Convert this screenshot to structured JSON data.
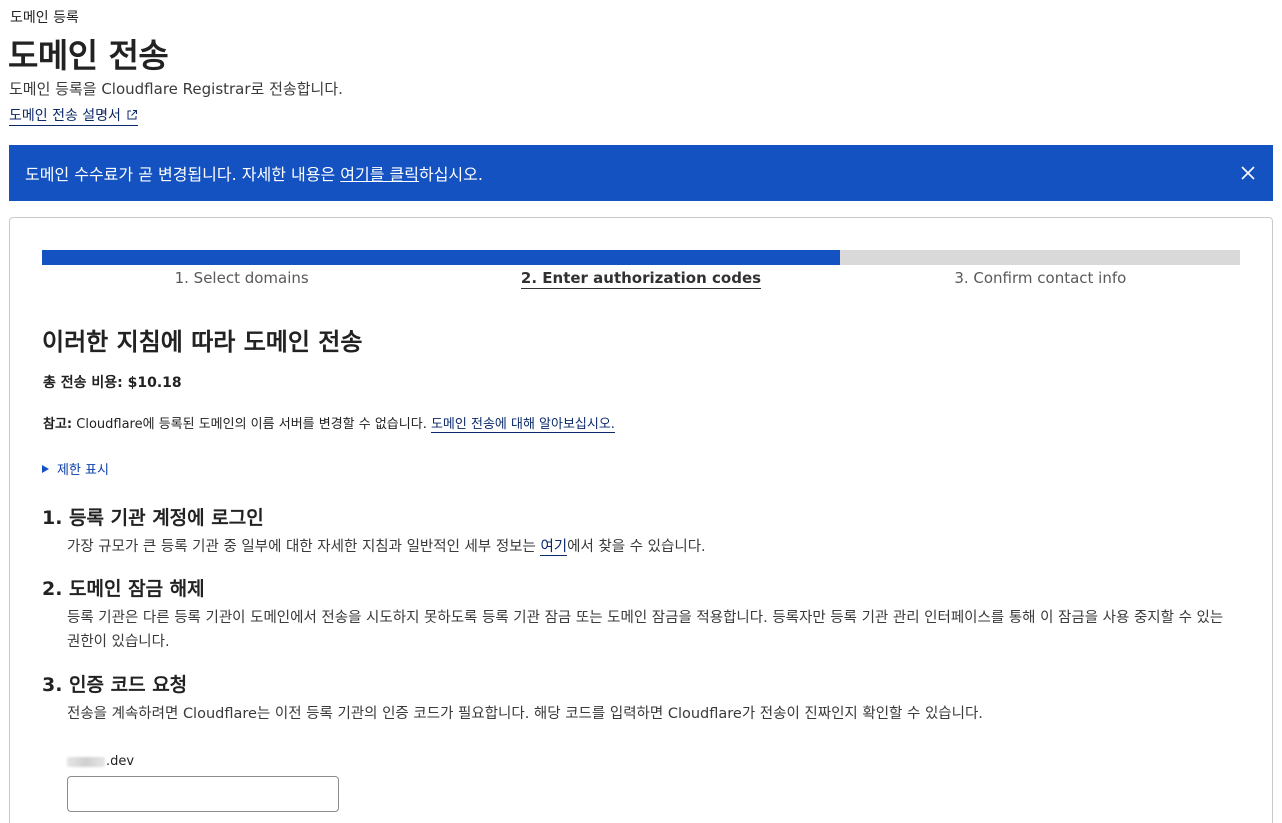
{
  "header": {
    "breadcrumb": "도메인 등록",
    "title": "도메인 전송",
    "subtitle": "도메인 등록을 Cloudflare Registrar로 전송합니다.",
    "doc_link": "도메인 전송 설명서"
  },
  "banner": {
    "text_before": "도메인 수수료가 곧 변경됩니다. 자세한 내용은 ",
    "link": "여기를 클릭",
    "text_after": "하십시오.",
    "color": "#1352c0"
  },
  "progress": {
    "fraction": 0.666,
    "steps": [
      {
        "label": "1. Select domains",
        "active": false
      },
      {
        "label": "2. Enter authorization codes",
        "active": true
      },
      {
        "label": "3. Confirm contact info",
        "active": false
      }
    ]
  },
  "main": {
    "section_title": "이러한 지침에 따라 도메인 전송",
    "total_cost": "총 전송 비용: $10.18",
    "note_label": "참고:",
    "note_text": " Cloudflare에 등록된 도메인의 이름 서버를 변경할 수 없습니다. ",
    "note_link": "도메인 전송에 대해 알아보십시오.",
    "limits_toggle": "제한 표시",
    "instructions": [
      {
        "title": "1. 등록 기관 계정에 로그인",
        "body_before": "가장 규모가 큰 등록 기관 중 일부에 대한 자세한 지침과 일반적인 세부 정보는 ",
        "body_link": "여기",
        "body_after": "에서 찾을 수 있습니다."
      },
      {
        "title": "2. 도메인 잠금 해제",
        "body": "등록 기관은 다른 등록 기관이 도메인에서 전송을 시도하지 못하도록 등록 기관 잠금 또는 도메인 잠금을 적용합니다. 등록자만 등록 기관 관리 인터페이스를 통해 이 잠금을 사용 중지할 수 있는 권한이 있습니다."
      },
      {
        "title": "3. 인증 코드 요청",
        "body": "전송을 계속하려면 Cloudflare는 이전 등록 기관의 인증 코드가 필요합니다. 해당 코드를 입력하면 Cloudflare가 전송이 진짜인지 확인할 수 있습니다."
      }
    ],
    "domain_suffix": ".dev",
    "auth_code_value": ""
  }
}
